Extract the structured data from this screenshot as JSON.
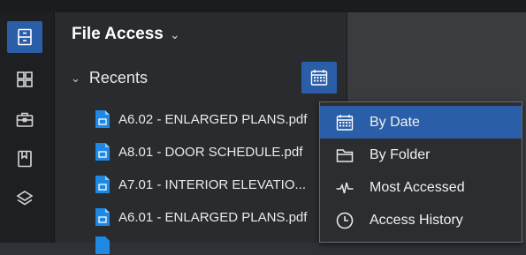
{
  "panel": {
    "title": "File Access",
    "title_chevron": "⌄",
    "section_label": "Recents",
    "section_chevron": "⌄"
  },
  "files": [
    {
      "name": "A6.02 - ENLARGED PLANS.pdf"
    },
    {
      "name": "A8.01 - DOOR SCHEDULE.pdf"
    },
    {
      "name": "A7.01 - INTERIOR ELEVATIO..."
    },
    {
      "name": "A6.01 - ENLARGED PLANS.pdf"
    }
  ],
  "sort_menu": {
    "items": [
      {
        "label": "By Date",
        "icon": "calendar-icon",
        "selected": true
      },
      {
        "label": "By Folder",
        "icon": "folder-icon",
        "selected": false
      },
      {
        "label": "Most Accessed",
        "icon": "pulse-icon",
        "selected": false
      },
      {
        "label": "Access History",
        "icon": "clock-icon",
        "selected": false
      }
    ]
  },
  "colors": {
    "accent": "#2b5ea8",
    "panel_bg": "#2a2b2f",
    "rail_bg": "#1e1f22",
    "pdf_icon": "#1e88e5"
  }
}
